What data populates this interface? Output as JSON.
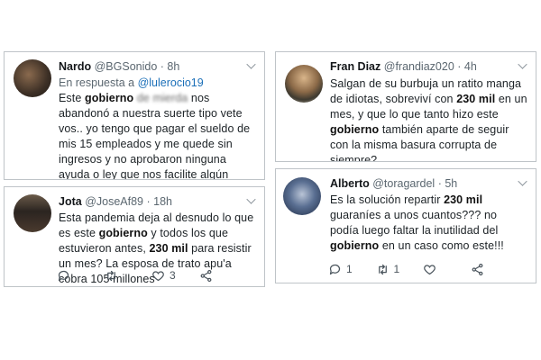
{
  "tweets": [
    {
      "name": "Nardo",
      "handle": "@BGSonido",
      "time": "· 8h",
      "reply_prefix": "En respuesta a ",
      "reply_handle": "@lulerocio19",
      "body": {
        "p1": "Este ",
        "b1": "gobierno",
        "p2": " ",
        "blurred": "de mierda",
        "p3": " nos abandonó a nuestra suerte tipo vete vos.. yo tengo que pagar el sueldo de mis 15 empleados y me quede sin ingresos y no aprobaron ninguna ayuda o ley que nos facilite algún crédito blando solo para los"
      }
    },
    {
      "name": "Jota",
      "handle": "@JoseAf89",
      "time": "· 18h",
      "body": {
        "p1": "Esta pandemia deja al desnudo lo que es este ",
        "b1": "gobierno",
        "p2": " y todos los que estuvieron antes, ",
        "b2": "230 mil",
        "p3": " para resistir un mes? La esposa de trato apu'a cobra 105 millones"
      },
      "actions": {
        "reply_count": "",
        "retweet_count": "",
        "like_count": "3"
      }
    },
    {
      "name": "Fran Diaz",
      "handle": "@frandiaz020",
      "time": "· 4h",
      "body": {
        "p1": "Salgan de su burbuja un ratito manga de idiotas, sobreviví con ",
        "b1": "230 mil",
        "p2": " en un mes, y que lo que tanto hizo este ",
        "b2": "gobierno",
        "p3": " también aparte de seguir con la misma basura corrupta de siempre?"
      }
    },
    {
      "name": "Alberto",
      "handle": "@toragardel",
      "time": "· 5h",
      "body": {
        "p1": "Es la solución repartir ",
        "b1": "230 mil",
        "p2": " guaraníes a unos cuantos??? no podía luego faltar la inutilidad del ",
        "b2": "gobierno",
        "p3": " en un caso como este!!!"
      },
      "actions": {
        "reply_count": "1",
        "retweet_count": "1",
        "like_count": ""
      }
    }
  ],
  "icons": {
    "reply": "reply-icon",
    "retweet": "retweet-icon",
    "like": "heart-icon",
    "share": "share-icon",
    "menu": "chevron-down-icon"
  },
  "colors": {
    "link": "#1b6fb8",
    "border": "#bfc4c8",
    "meta": "#5b6770"
  }
}
